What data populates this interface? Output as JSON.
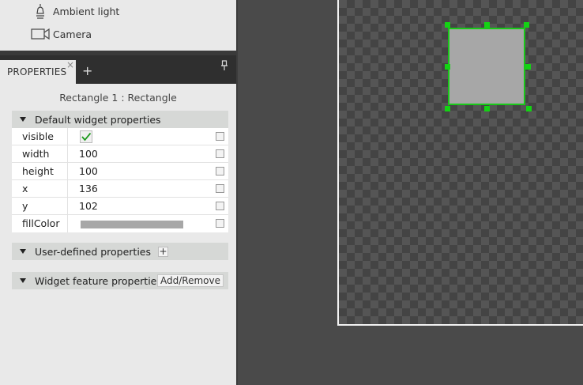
{
  "library": {
    "items": [
      {
        "label": "Ambient light",
        "icon": "ambient-light-icon"
      },
      {
        "label": "Camera",
        "icon": "camera-icon"
      }
    ]
  },
  "tabs": {
    "properties_label": "PROPERTIES",
    "close_glyph": "×",
    "add_glyph": "+"
  },
  "object_title": "Rectangle 1 : Rectangle",
  "sections": {
    "default": "Default widget properties",
    "user_defined": "User-defined properties",
    "feature": "Widget feature properties",
    "add_remove": "Add/Remove",
    "plus_glyph": "+"
  },
  "properties": [
    {
      "name": "visible",
      "value": "",
      "checked": true
    },
    {
      "name": "width",
      "value": "100"
    },
    {
      "name": "height",
      "value": "100"
    },
    {
      "name": "x",
      "value": "136"
    },
    {
      "name": "y",
      "value": "102"
    },
    {
      "name": "fillColor",
      "value": ""
    }
  ],
  "colors": {
    "selection": "#19c819",
    "fill": "#a7a7a7"
  }
}
